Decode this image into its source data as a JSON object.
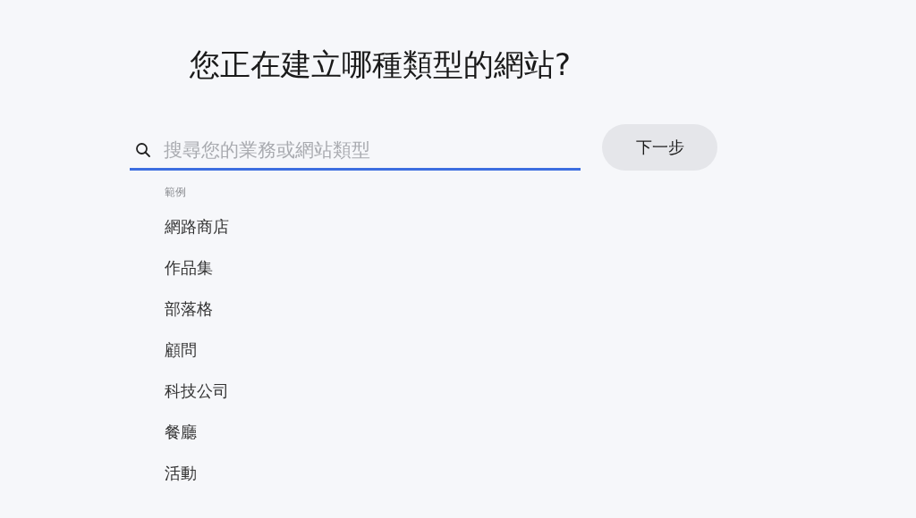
{
  "title": "您正在建立哪種類型的網站?",
  "search": {
    "placeholder": "搜尋您的業務或網站類型"
  },
  "next_button": "下一步",
  "examples": {
    "heading": "範例",
    "items": [
      "網路商店",
      "作品集",
      "部落格",
      "顧問",
      "科技公司",
      "餐廳",
      "活動"
    ]
  }
}
